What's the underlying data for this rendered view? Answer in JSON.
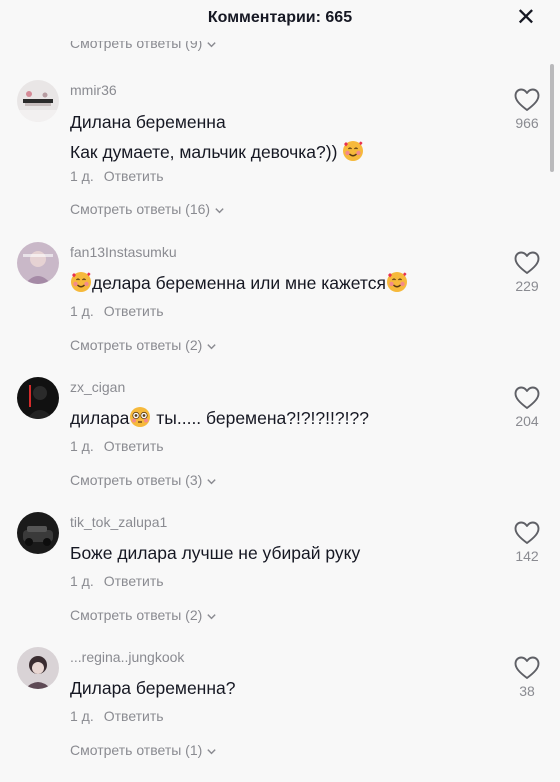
{
  "header": {
    "title": "Комментарии: 665",
    "close": "✕"
  },
  "top_view_replies": "Смотреть ответы (9)",
  "comments": [
    {
      "username": "mmir36",
      "lines": [
        "Дилана беременна",
        "Как думаете, мальчик девочка?))"
      ],
      "emoji": "smiling-face-with-hearts",
      "time": "1 д.",
      "reply": "Ответить",
      "likes": "966",
      "view_replies": "Смотреть ответы (16)"
    },
    {
      "username": "fan13Instasumku",
      "text": "делара беременна или мне кажется",
      "emoji": "smiling-face-with-hearts",
      "time": "1 д.",
      "reply": "Ответить",
      "likes": "229",
      "view_replies": "Смотреть ответы (2)"
    },
    {
      "username": "zx_cigan",
      "text_a": "дилара",
      "text_b": " ты..... беремена?!?!?!!?!??",
      "emoji": "flushed-face",
      "time": "1 д.",
      "reply": "Ответить",
      "likes": "204",
      "view_replies": "Смотреть ответы (3)"
    },
    {
      "username": "tik_tok_zalupa1",
      "text": "Боже дилара лучше не убирай руку",
      "time": "1 д.",
      "reply": "Ответить",
      "likes": "142",
      "view_replies": "Смотреть ответы (2)"
    },
    {
      "username": "...regina..jungkook",
      "text": "Дилара беременна?",
      "time": "1 д.",
      "reply": "Ответить",
      "likes": "38",
      "view_replies": "Смотреть ответы (1)"
    }
  ],
  "icons": {
    "like": "heart-outline-icon",
    "expand": "chevron-down-icon",
    "close": "close-icon"
  }
}
